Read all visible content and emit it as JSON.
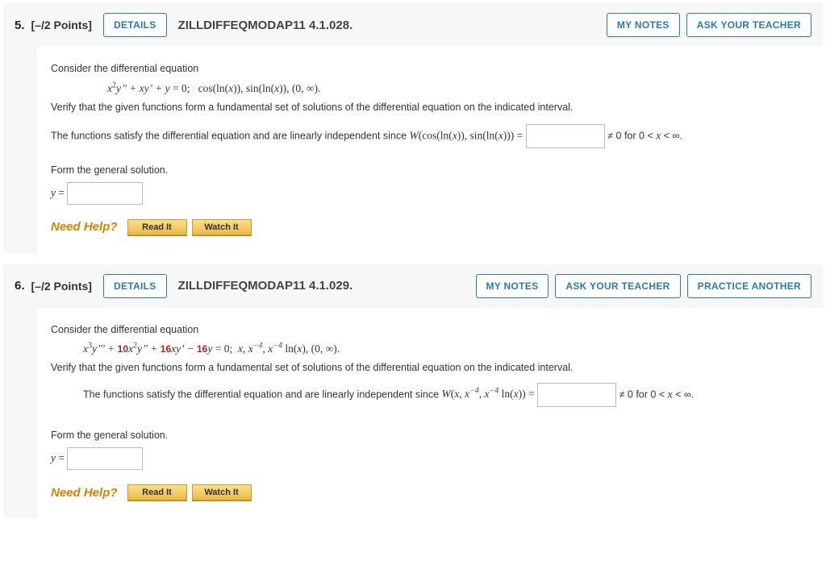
{
  "q5": {
    "number": "5.",
    "points": "[–/2 Points]",
    "details": "DETAILS",
    "textbook": "ZILLDIFFEQMODAP11 4.1.028.",
    "my_notes": "MY NOTES",
    "ask": "ASK YOUR TEACHER",
    "consider": "Consider the differential equation",
    "verify": "Verify that the given functions form a fundamental set of solutions of the differential equation on the indicated interval.",
    "satisfy_pre": "The functions satisfy the differential equation and are linearly independent since ",
    "neq_post": " ≠ 0 for 0 < ",
    "lt_inf": " < ∞.",
    "form": "Form the general solution.",
    "need_help": "Need Help?",
    "read_it": "Read It",
    "watch_it": "Watch It"
  },
  "q6": {
    "number": "6.",
    "points": "[–/2 Points]",
    "details": "DETAILS",
    "textbook": "ZILLDIFFEQMODAP11 4.1.029.",
    "my_notes": "MY NOTES",
    "ask": "ASK YOUR TEACHER",
    "practice": "PRACTICE ANOTHER",
    "consider": "Consider the differential equation",
    "verify": "Verify that the given functions form a fundamental set of solutions of the differential equation on the indicated interval.",
    "satisfy_pre": "The functions satisfy the differential equation and are linearly independent since ",
    "neq_post": " ≠ 0 for 0 < ",
    "lt_inf": " < ∞.",
    "form": "Form the general solution.",
    "need_help": "Need Help?",
    "read_it": "Read It",
    "watch_it": "Watch It"
  }
}
